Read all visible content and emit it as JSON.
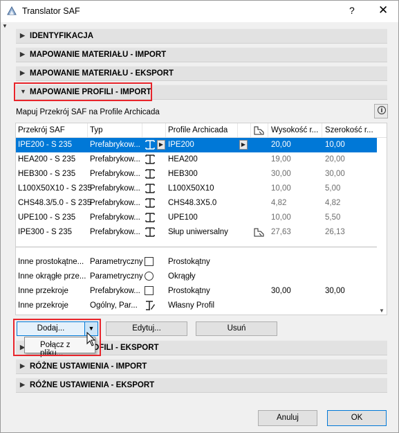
{
  "window": {
    "title": "Translator SAF",
    "help_label": "?",
    "close_label": "✕"
  },
  "sections_top": [
    {
      "label": "IDENTYFIKACJA"
    },
    {
      "label": "MAPOWANIE MATERIAŁU - IMPORT"
    },
    {
      "label": "MAPOWANIE MATERIAŁU - EKSPORT"
    },
    {
      "label": "MAPOWANIE PROFILI - IMPORT"
    }
  ],
  "profile_import": {
    "subtitle": "Mapuj Przekrój SAF na Profile Archicada",
    "columns": [
      "Przekrój SAF",
      "Typ",
      "Profile Archicada",
      "Wysokość r...",
      "Szerokość r..."
    ],
    "rows": [
      {
        "saf": "IPE200 - S 235",
        "type": "Prefabrykow...",
        "profile": "IPE200",
        "height": "20,00",
        "width": "10,00"
      },
      {
        "saf": "HEA200 - S 235",
        "type": "Prefabrykow...",
        "profile": "HEA200",
        "height": "19,00",
        "width": "20,00"
      },
      {
        "saf": "HEB300 - S 235",
        "type": "Prefabrykow...",
        "profile": "HEB300",
        "height": "30,00",
        "width": "30,00"
      },
      {
        "saf": "L100X50X10 - S 235",
        "type": "Prefabrykow...",
        "profile": "L100X50X10",
        "height": "10,00",
        "width": "5,00"
      },
      {
        "saf": "CHS48.3/5.0 - S 235",
        "type": "Prefabrykow...",
        "profile": "CHS48.3X5.0",
        "height": "4,82",
        "width": "4,82"
      },
      {
        "saf": "UPE100 - S 235",
        "type": "Prefabrykow...",
        "profile": "UPE100",
        "height": "10,00",
        "width": "5,50"
      },
      {
        "saf": "IPE300 - S 235",
        "type": "Prefabrykow...",
        "profile": "Słup uniwersalny",
        "height": "27,63",
        "width": "26,13"
      }
    ],
    "other_rows": [
      {
        "saf": "Inne prostokątne...",
        "type": "Parametryczny",
        "profile": "Prostokątny",
        "height": "",
        "width": ""
      },
      {
        "saf": "Inne okrągłe prze...",
        "type": "Parametryczny",
        "profile": "Okrągły",
        "height": "",
        "width": ""
      },
      {
        "saf": "Inne przekroje",
        "type": "Prefabrykow...",
        "profile": "Prostokątny",
        "height": "30,00",
        "width": "30,00"
      },
      {
        "saf": "Inne przekroje",
        "type": "Ogólny, Par...",
        "profile": "Własny Profil",
        "height": "",
        "width": ""
      }
    ],
    "buttons": {
      "add": "Dodaj...",
      "edit": "Edytuj...",
      "delete": "Usuń"
    },
    "add_menu_item": "Połącz z pliku..."
  },
  "sections_bottom": [
    {
      "label": "MAPOWANIE PROFILI - EKSPORT"
    },
    {
      "label": "RÓŻNE USTAWIENIA - IMPORT"
    },
    {
      "label": "RÓŻNE USTAWIENIA - EKSPORT"
    }
  ],
  "footer": {
    "cancel": "Anuluj",
    "ok": "OK"
  },
  "colors": {
    "selection": "#0078d7",
    "highlight_box": "#e8242b"
  },
  "icons": [
    "app-icon",
    "info-icon",
    "i-beam-icon",
    "rectangle-profile-icon",
    "circle-profile-icon",
    "custom-profile-icon",
    "complex-profile-icon",
    "arrow-right-icon",
    "chevron-down-icon",
    "mouse-cursor-icon"
  ]
}
